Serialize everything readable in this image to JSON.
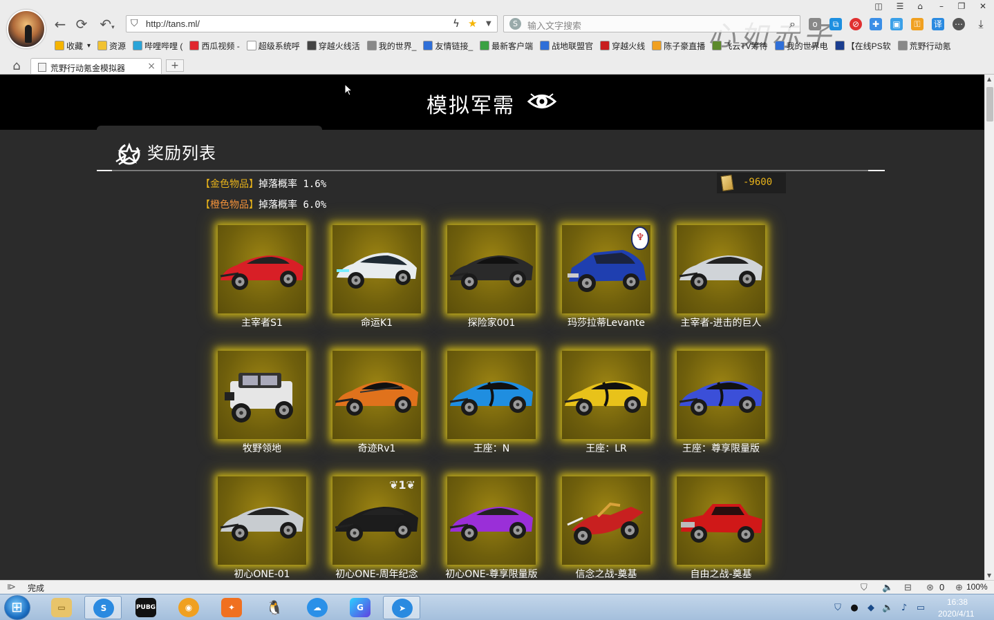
{
  "browser": {
    "url": "http://tans.ml/",
    "search_placeholder": "输入文字搜索",
    "tab_title": "荒野行动氪金模拟器",
    "new_tab": "+",
    "tab_close": "×",
    "bookmarks": [
      {
        "label": "收藏",
        "icon_color": "#f5b400"
      },
      {
        "label": "资源",
        "icon_color": "#f1c232"
      },
      {
        "label": "哔哩哔哩 (",
        "icon_color": "#2aa4d8"
      },
      {
        "label": "西瓜视频 -",
        "icon_color": "#e0262e"
      },
      {
        "label": "超级系统呼",
        "icon_color": "#ffffff"
      },
      {
        "label": "穿越火线活",
        "icon_color": "#444444"
      },
      {
        "label": "我的世界_",
        "icon_color": "#888888"
      },
      {
        "label": "友情链接_",
        "icon_color": "#2f6fd8"
      },
      {
        "label": "最新客户端",
        "icon_color": "#3aa142"
      },
      {
        "label": "战地联盟官",
        "icon_color": "#2f6fd8"
      },
      {
        "label": "穿越火线",
        "icon_color": "#c81e1e"
      },
      {
        "label": "陈子豪直播",
        "icon_color": "#f0a020"
      },
      {
        "label": "飞云TV筹待",
        "icon_color": "#5c8a2b"
      },
      {
        "label": "我的世界电",
        "icon_color": "#2f6fd8"
      },
      {
        "label": "【在线PS软",
        "icon_color": "#1a3d8f"
      },
      {
        "label": "荒野行动氪",
        "icon_color": "#888888"
      }
    ]
  },
  "page": {
    "title": "模拟军需",
    "section_title": "奖励列表",
    "rates": [
      {
        "bracket_open": "【",
        "name": "金色物品",
        "bracket_close": "】",
        "label": "掉落概率",
        "value": "1.6%"
      },
      {
        "bracket_open": "【",
        "name": "橙色物品",
        "bracket_close": "】",
        "label": "掉落概率",
        "value": "6.0%"
      }
    ],
    "cost": "-9600",
    "items": [
      {
        "name": "主宰者S1",
        "color": "#d81f26",
        "type": "sports"
      },
      {
        "name": "命运K1",
        "color": "#e8ecee",
        "type": "sedan"
      },
      {
        "name": "探险家001",
        "color": "#2a2a2a",
        "type": "coupe"
      },
      {
        "name": "玛莎拉蒂Levante",
        "color": "#1f3fb0",
        "type": "suv"
      },
      {
        "name": "主宰者-进击的巨人",
        "color": "#d0d4d8",
        "type": "sports"
      },
      {
        "name": "牧野领地",
        "color": "#e6e6e6",
        "type": "jeep"
      },
      {
        "name": "奇迹Rv1",
        "color": "#e0721c",
        "type": "super"
      },
      {
        "name": "王座：N",
        "color": "#1f8ee0",
        "type": "hyper"
      },
      {
        "name": "王座：LR",
        "color": "#e8c21a",
        "type": "hyper"
      },
      {
        "name": "王座：尊享限量版",
        "color": "#3b4fd8",
        "type": "hyper"
      },
      {
        "name": "初心ONE-01",
        "color": "#c8ccd0",
        "type": "roadster"
      },
      {
        "name": "初心ONE-周年纪念",
        "color": "#1c1c1c",
        "type": "roadster"
      },
      {
        "name": "初心ONE-尊享限量版",
        "color": "#9a2fd8",
        "type": "roadster"
      },
      {
        "name": "信念之战-奠基",
        "color": "#c82020",
        "type": "moto"
      },
      {
        "name": "自由之战-奠基",
        "color": "#d01818",
        "type": "classic"
      }
    ]
  },
  "status": {
    "text": "完成",
    "zoom": "100%",
    "blocked_count": "0"
  },
  "taskbar": {
    "clock_time": "16:38",
    "clock_date": "2020/4/11",
    "pubg_label": "PUBG"
  }
}
